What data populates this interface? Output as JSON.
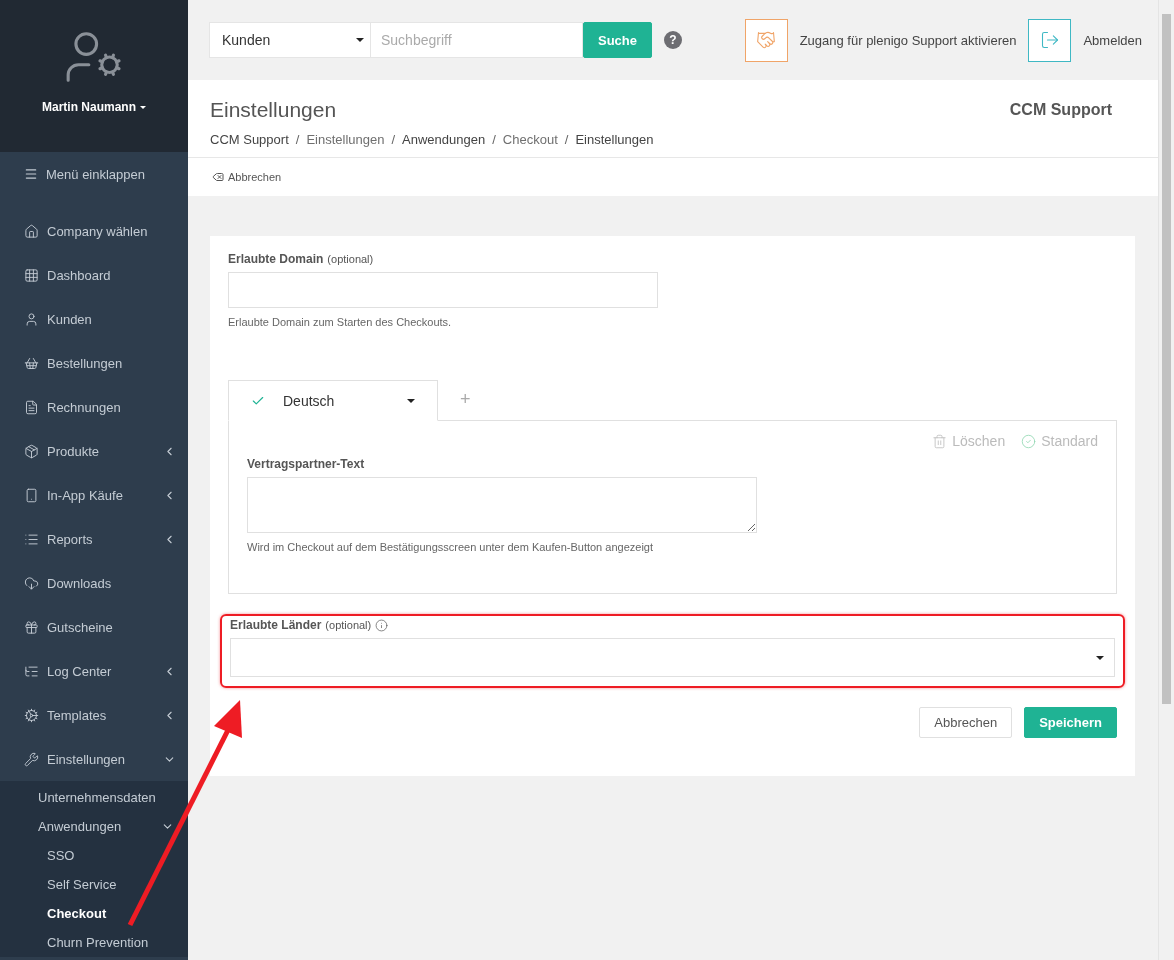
{
  "user": {
    "name": "Martin Naumann"
  },
  "sidebar": {
    "collapse_label": "Menü einklappen",
    "items": [
      {
        "label": "Company wählen",
        "selected": false
      },
      {
        "label": "Dashboard",
        "selected": false
      },
      {
        "label": "Kunden",
        "selected": false
      },
      {
        "label": "Bestellungen",
        "selected": false
      },
      {
        "label": "Rechnungen",
        "selected": false
      },
      {
        "label": "Produkte",
        "selected": false,
        "expanded": false
      },
      {
        "label": "In-App Käufe",
        "selected": false,
        "expanded": false
      },
      {
        "label": "Reports",
        "selected": false,
        "expanded": false
      },
      {
        "label": "Downloads",
        "selected": false
      },
      {
        "label": "Gutscheine",
        "selected": false
      },
      {
        "label": "Log Center",
        "selected": false,
        "expanded": false
      },
      {
        "label": "Templates",
        "selected": false,
        "expanded": false
      },
      {
        "label": "Einstellungen",
        "selected": false,
        "expanded": true,
        "children": [
          {
            "label": "Unternehmensdaten",
            "selected": false
          },
          {
            "label": "Anwendungen",
            "selected": false,
            "expanded": true,
            "children": [
              {
                "label": "SSO",
                "selected": false
              },
              {
                "label": "Self Service",
                "selected": false
              },
              {
                "label": "Checkout",
                "selected": true
              },
              {
                "label": "Churn Prevention",
                "selected": false
              }
            ]
          }
        ]
      }
    ]
  },
  "topbar": {
    "search_scope": "Kunden",
    "search": {
      "placeholder": "Suchbegriff"
    },
    "search_button": "Suche",
    "help": "?",
    "support_label": "Zugang für plenigo Support aktivieren",
    "logout_label": "Abmelden"
  },
  "header": {
    "title": "Einstellungen",
    "company": "CCM Support",
    "breadcrumbs": [
      "CCM Support",
      "Einstellungen",
      "Anwendungen",
      "Checkout",
      "Einstellungen"
    ],
    "breadcrumb_separator": "/",
    "cancel_link": "Abbrechen"
  },
  "form": {
    "domain": {
      "label": "Erlaubte Domain",
      "optional": "(optional)",
      "help": "Erlaubte Domain zum Starten des Checkouts."
    },
    "language_tabs": [
      {
        "label": "Deutsch",
        "selected": true,
        "valid": true
      }
    ],
    "add_tab": "+",
    "panel_actions": {
      "delete": "Löschen",
      "default": "Standard"
    },
    "contract_text": {
      "label": "Vertragspartner-Text",
      "help": "Wird im Checkout auf dem Bestätigungsscreen unter dem Kaufen-Button angezeigt"
    },
    "countries": {
      "label": "Erlaubte Länder",
      "optional": "(optional)"
    },
    "buttons": [
      {
        "label": "Abbrechen",
        "kind": "secondary"
      },
      {
        "label": "Speichern",
        "kind": "primary"
      }
    ]
  }
}
